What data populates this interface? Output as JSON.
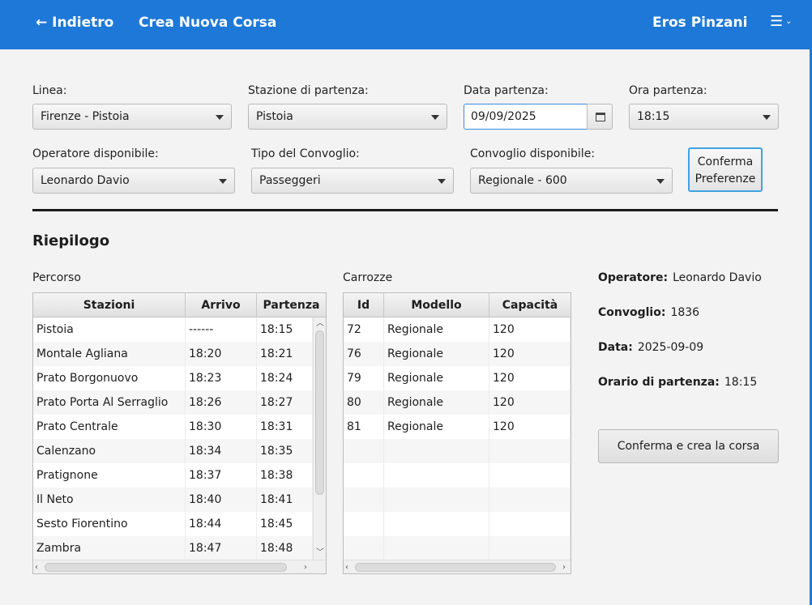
{
  "header": {
    "back_label": "← Indietro",
    "title": "Crea Nuova Corsa",
    "user": "Eros Pinzani",
    "menu_icon": "☰"
  },
  "form": {
    "linea_label": "Linea:",
    "linea_value": "Firenze - Pistoia",
    "stazione_label": "Stazione di partenza:",
    "stazione_value": "Pistoia",
    "data_label": "Data partenza:",
    "data_value": "09/09/2025",
    "ora_label": "Ora partenza:",
    "ora_value": "18:15",
    "operatore_label": "Operatore disponibile:",
    "operatore_value": "Leonardo Davio",
    "tipo_label": "Tipo del Convoglio:",
    "tipo_value": "Passeggeri",
    "convoglio_label": "Convoglio disponibile:",
    "convoglio_value": "Regionale - 600",
    "conferma_pref_line1": "Conferma",
    "conferma_pref_line2": "Preferenze"
  },
  "summary": {
    "title": "Riepilogo",
    "percorso_label": "Percorso",
    "carrozze_label": "Carrozze"
  },
  "percorso_table": {
    "columns": [
      "Stazioni",
      "Arrivo",
      "Partenza"
    ],
    "rows": [
      [
        "Pistoia",
        "------",
        "18:15"
      ],
      [
        "Montale Agliana",
        "18:20",
        "18:21"
      ],
      [
        "Prato Borgonuovo",
        "18:23",
        "18:24"
      ],
      [
        "Prato Porta Al Serraglio",
        "18:26",
        "18:27"
      ],
      [
        "Prato Centrale",
        "18:30",
        "18:31"
      ],
      [
        "Calenzano",
        "18:34",
        "18:35"
      ],
      [
        "Pratignone",
        "18:37",
        "18:38"
      ],
      [
        "Il Neto",
        "18:40",
        "18:41"
      ],
      [
        "Sesto Fiorentino",
        "18:44",
        "18:45"
      ],
      [
        "Zambra",
        "18:47",
        "18:48"
      ]
    ]
  },
  "carrozze_table": {
    "columns": [
      "Id",
      "Modello",
      "Capacità"
    ],
    "rows": [
      [
        "72",
        "Regionale",
        "120"
      ],
      [
        "76",
        "Regionale",
        "120"
      ],
      [
        "79",
        "Regionale",
        "120"
      ],
      [
        "80",
        "Regionale",
        "120"
      ],
      [
        "81",
        "Regionale",
        "120"
      ]
    ],
    "empty_rows": 5
  },
  "info": {
    "operatore_label": "Operatore:",
    "operatore_value": "Leonardo Davio",
    "convoglio_label": "Convoglio:",
    "convoglio_value": "1836",
    "data_label": "Data:",
    "data_value": "2025-09-09",
    "orario_label": "Orario di partenza:",
    "orario_value": "18:15"
  },
  "confirm_button": "Conferma e crea la corsa",
  "colors": {
    "header": "#1e78d7",
    "focus": "#3fa3e0"
  }
}
